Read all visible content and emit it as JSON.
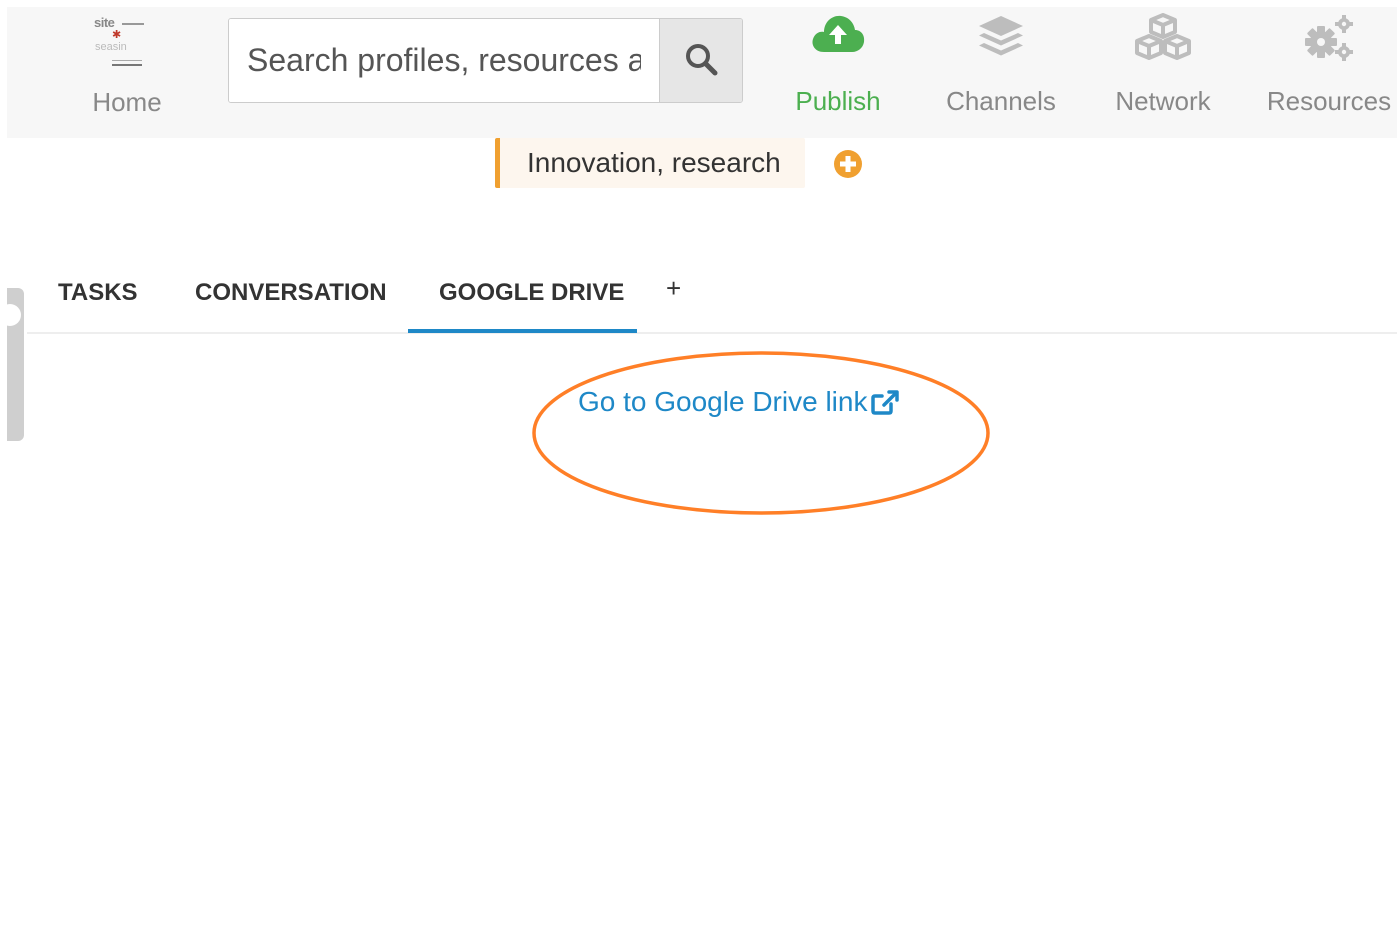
{
  "header": {
    "home": {
      "logo_text_top": "site",
      "logo_text_bottom": "seasin",
      "label": "Home"
    },
    "search": {
      "placeholder": "Search profiles, resources and"
    },
    "nav": {
      "publish": {
        "label": "Publish",
        "icon": "cloud-upload-icon",
        "color": "#4caf50"
      },
      "channels": {
        "label": "Channels",
        "icon": "layers-icon"
      },
      "network": {
        "label": "Network",
        "icon": "cubes-icon"
      },
      "resources": {
        "label": "Resources",
        "icon": "gears-icon"
      }
    }
  },
  "tag": {
    "label": "Innovation, research",
    "accent": "#f0a030"
  },
  "tabs": {
    "items": [
      {
        "label": "TASKS",
        "active": false
      },
      {
        "label": "CONVERSATION",
        "active": false
      },
      {
        "label": "GOOGLE DRIVE",
        "active": true
      }
    ],
    "add_label": "+"
  },
  "content": {
    "link_text": "Go to Google Drive link",
    "link_icon": "external-link-icon",
    "link_color": "#1e88c7",
    "annotation_color": "#ff7f27"
  }
}
